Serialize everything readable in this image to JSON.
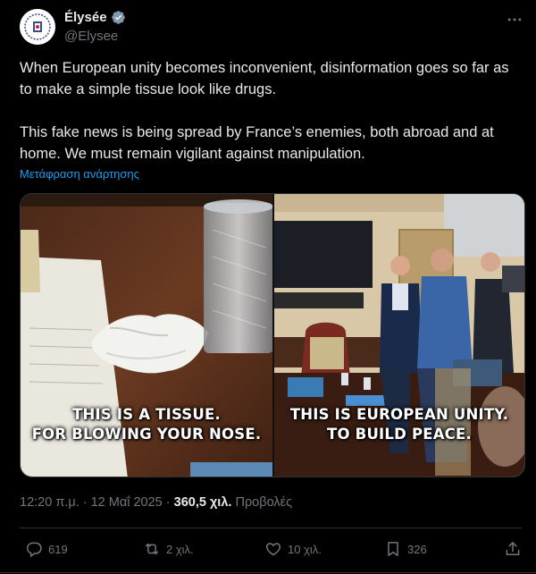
{
  "author": {
    "name": "Élysée",
    "handle": "@Elysee",
    "avatar_icon": "elysee-seal-icon"
  },
  "post": {
    "paragraph1": "When European unity becomes inconvenient, disinformation goes so far as to make a simple tissue look like drugs.",
    "paragraph2": "This fake news is being spread by France’s enemies, both abroad and at home. We must remain vigilant against manipulation.",
    "translate_label": "Μετάφραση ανάρτησης"
  },
  "media": {
    "left_caption_line1": "THIS IS A TISSUE.",
    "left_caption_line2": "FOR BLOWING YOUR NOSE.",
    "right_caption_line1": "THIS IS EUROPEAN UNITY.",
    "right_caption_line2": "TO BUILD PEACE."
  },
  "meta": {
    "timestamp": "12:20 π.μ. · 12 Μαΐ 2025 · ",
    "views": "360,5 χιλ.",
    "views_label": " Προβολές"
  },
  "actions": {
    "replies": "619",
    "reposts": "2 χιλ.",
    "likes": "10 χιλ.",
    "bookmarks": "326"
  },
  "colors": {
    "background": "#000000",
    "text": "#e7e9ea",
    "muted": "#71767b",
    "link": "#1d9bf0",
    "verified": "#829aab"
  }
}
